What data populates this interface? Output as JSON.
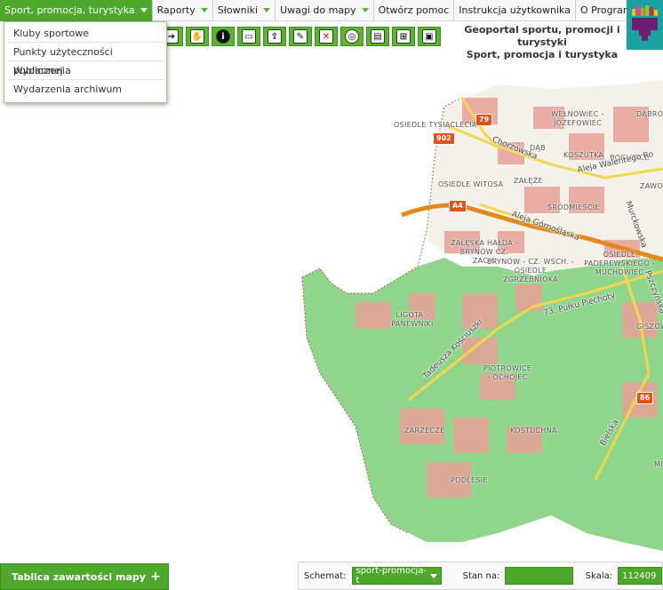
{
  "menu": [
    {
      "label": "Sport, promocja, turystyka",
      "has_caret": true,
      "active": true
    },
    {
      "label": "Raporty",
      "has_caret": true
    },
    {
      "label": "Słowniki",
      "has_caret": true
    },
    {
      "label": "Uwagi do mapy",
      "has_caret": true
    },
    {
      "label": "Otwórz pomoc"
    },
    {
      "label": "Instrukcja użytkownika"
    },
    {
      "label": "O Programie..."
    }
  ],
  "dropdown": [
    "Kluby sportowe",
    "Punkty użyteczności publicznej",
    "Wydarzenia",
    "Wydarzenia archiwum"
  ],
  "toolbar": [
    "arrow-in-icon",
    "hand-pan-icon",
    "info-icon",
    "comment-icon",
    "upload-icon",
    "edit-icon",
    "clear-selection-icon",
    "zoom-icon",
    "print-icon",
    "coordinates-icon",
    "image-icon"
  ],
  "title": {
    "line1": "Geoportal sportu, promocji i turystyki",
    "line2": "Sport, promocja i turystyka"
  },
  "map_labels": [
    "OSIEDLE TYSIĄCLECIA",
    "WEŁNOWIEC - JÓZEFOWIEC",
    "DĄBRÓ",
    "DĄB",
    "KOSZUTKA",
    "BOGUCICE",
    "ZAŁĘŻE",
    "OSIEDLE WITOSA",
    "ŚRÓDMIEŚCIE",
    "ZAWOD",
    "ZAŁĘSKA HAŁDA - BRYNÓW CZ. ZACH.",
    "BRYNÓW - CZ. WSCH. - OSIEDLE ZGRZEBNIOKA",
    "OSIEDLE PADEREWSKIEGO - MUCHOWIEC",
    "LIGOTA - PANEWNIKI",
    "PIOTROWICE - OCHOJEC",
    "GISZOW",
    "ZARZECZE",
    "KOSTUCHNA",
    "PODLESIE",
    "MI"
  ],
  "road_labels": [
    "Chorzowska",
    "Aleja Walentego Ro",
    "Aleja Górnośląska",
    "Murckowska",
    "Pszczyńska",
    "73. Pułku Piechoty",
    "Tadeusza Kościuszki",
    "Bielska"
  ],
  "shields": [
    "79",
    "902",
    "A4",
    "86"
  ],
  "legend_panel": {
    "label": "Tablica zawartości mapy",
    "toggle": "+"
  },
  "status": {
    "schema_label": "Schemat:",
    "schema_value": "sport-promocja-t",
    "stan_label": "Stan na:",
    "stan_value": "",
    "scale_label": "Skala:",
    "scale_value": "112409"
  }
}
